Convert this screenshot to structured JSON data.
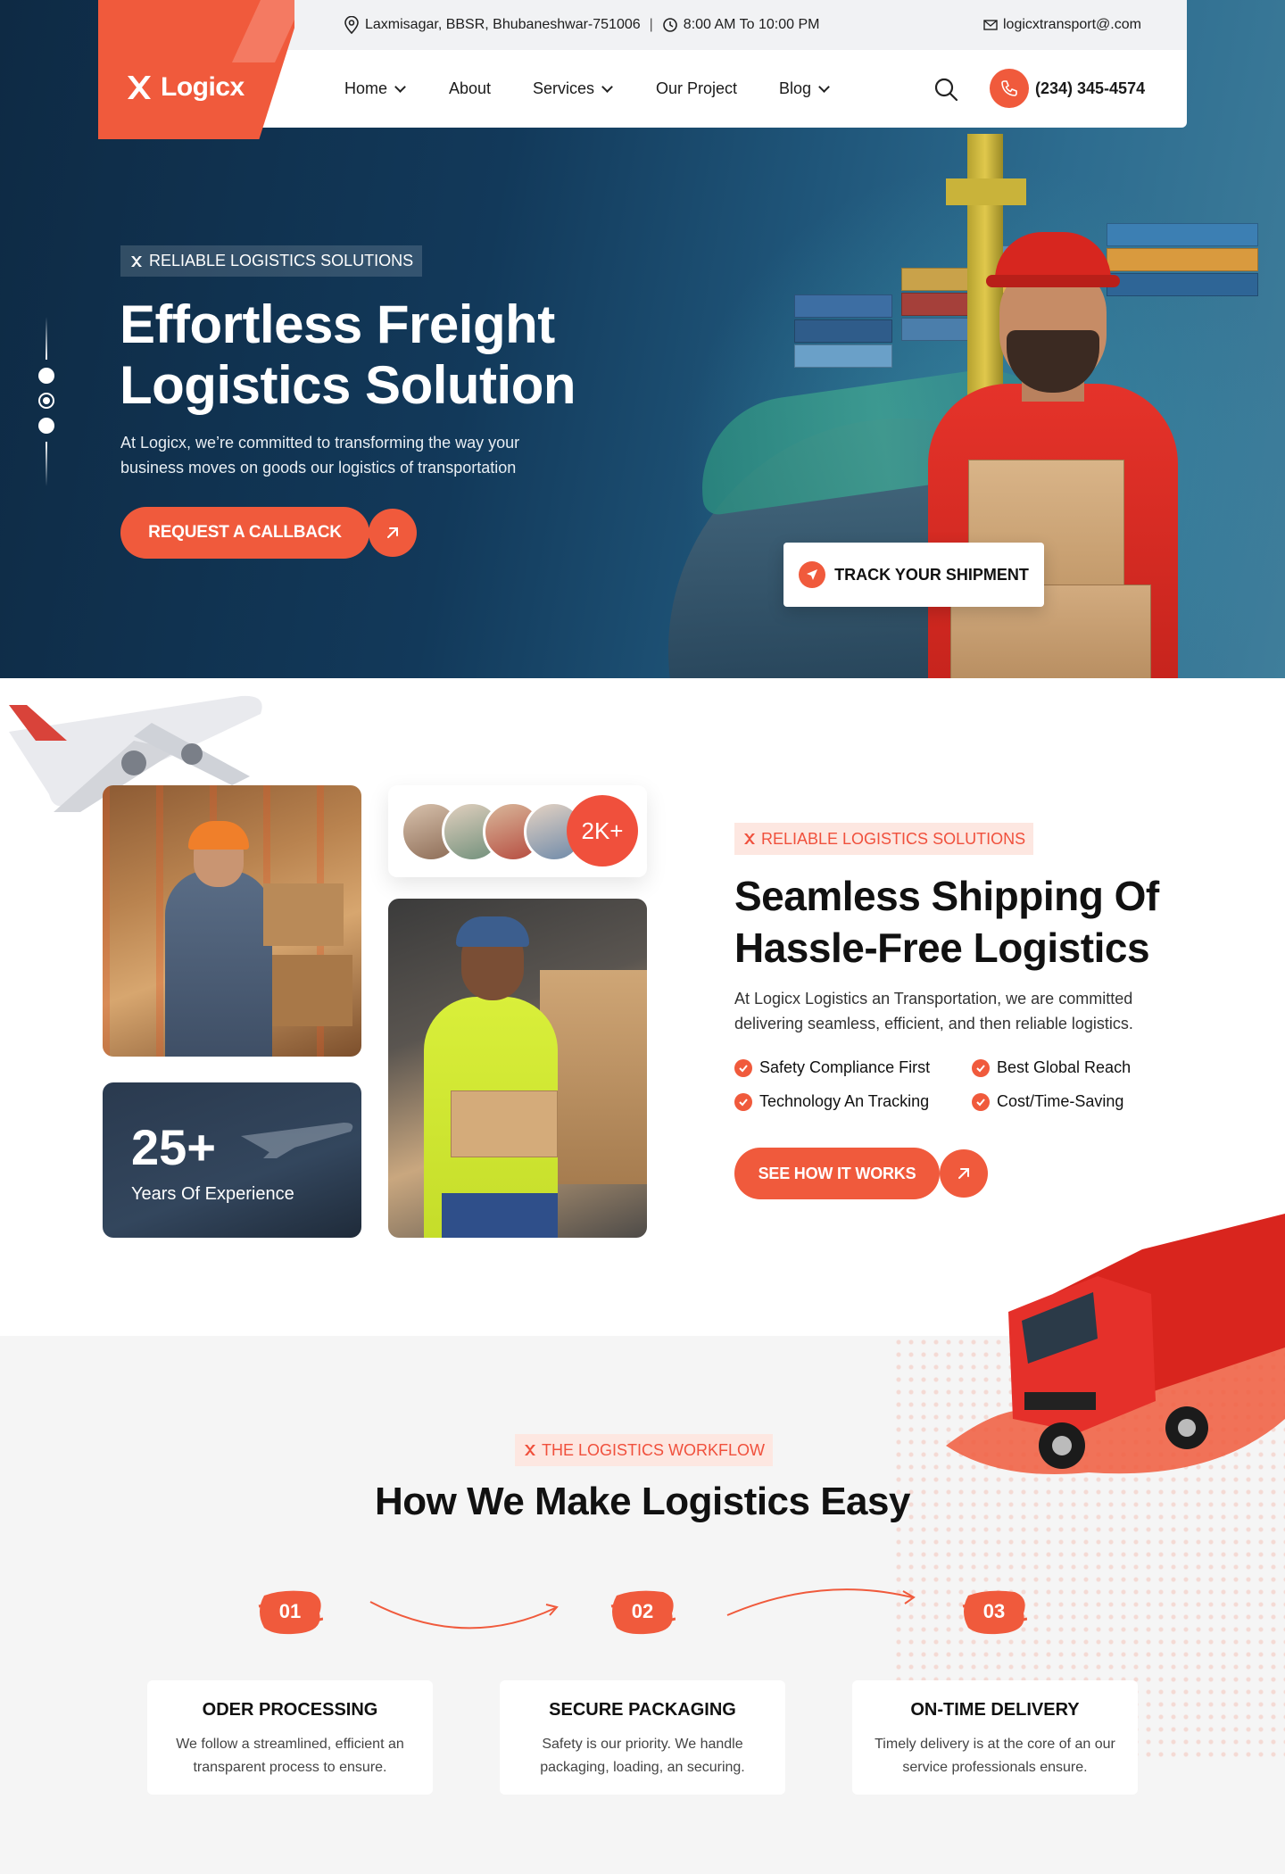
{
  "brand": {
    "name": "Logicx",
    "accent": "#f05a3c"
  },
  "topbar": {
    "address": "Laxmisagar, BBSR, Bhubaneshwar-751006",
    "hours": "8:00 AM To 10:00 PM",
    "email": "logicxtransport@.com"
  },
  "nav": {
    "items": [
      {
        "label": "Home",
        "dropdown": true
      },
      {
        "label": "About",
        "dropdown": false
      },
      {
        "label": "Services",
        "dropdown": true
      },
      {
        "label": "Our Project",
        "dropdown": false
      },
      {
        "label": "Blog",
        "dropdown": true
      }
    ],
    "phone": "(234) 345-4574"
  },
  "hero": {
    "tag": "RELIABLE LOGISTICS SOLUTIONS",
    "title_line1": "Effortless Freight",
    "title_line2": "Logistics Solution",
    "description": "At Logicx, we’re committed to transforming the way your business moves on goods our logistics of transportation",
    "cta": "REQUEST A CALLBACK",
    "track": "TRACK YOUR SHIPMENT",
    "slider": {
      "slides": 3,
      "active": 2
    }
  },
  "about": {
    "customers": "2K+",
    "experience_value": "25+",
    "experience_label": "Years Of Experience",
    "tag": "RELIABLE LOGISTICS SOLUTIONS",
    "title_line1": "Seamless Shipping Of",
    "title_line2": "Hassle-Free Logistics",
    "description": "At Logicx Logistics an Transportation, we are committed delivering seamless, efficient, and then reliable logistics.",
    "features": [
      "Safety Compliance First",
      "Best Global Reach",
      "Technology An Tracking",
      "Cost/Time-Saving"
    ],
    "cta": "SEE HOW IT WORKS"
  },
  "workflow": {
    "tag": "THE LOGISTICS WORKFLOW",
    "title": "How We Make Logistics Easy",
    "steps": [
      {
        "num": "01",
        "title": "ODER PROCESSING",
        "desc": "We follow a streamlined, efficient an transparent process to ensure."
      },
      {
        "num": "02",
        "title": "SECURE PACKAGING",
        "desc": "Safety is our priority. We handle packaging, loading, an securing."
      },
      {
        "num": "03",
        "title": "ON-TIME DELIVERY",
        "desc": "Timely delivery is at the core of an our service professionals ensure."
      }
    ]
  }
}
